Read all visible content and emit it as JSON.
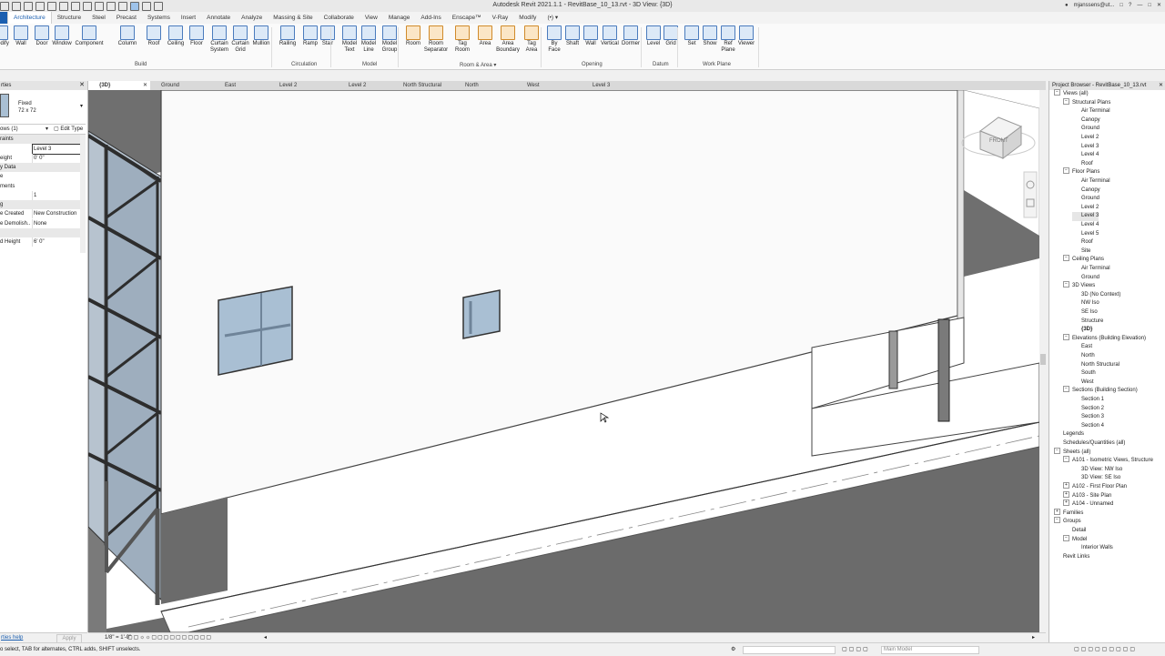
{
  "app_title": "Autodesk Revit 2021.1.1 - RevitBase_10_13.rvt - 3D View: {3D}",
  "user": "mjanssens@ut...",
  "ribbon_tabs": [
    "Architecture",
    "Structure",
    "Steel",
    "Precast",
    "Systems",
    "Insert",
    "Annotate",
    "Analyze",
    "Massing & Site",
    "Collaborate",
    "View",
    "Manage",
    "Add-Ins",
    "Enscape™",
    "V-Ray",
    "Modify"
  ],
  "ribbon_active_tab": "Architecture",
  "ribbon_buttons": [
    "Modify",
    "Wall",
    "Door",
    "Window",
    "Component",
    "Column",
    "Roof",
    "Ceiling",
    "Floor",
    "Curtain\nSystem",
    "Curtain\nGrid",
    "Mullion",
    "Railing",
    "Ramp",
    "Stair",
    "Model\nText",
    "Model\nLine",
    "Model\nGroup",
    "Room",
    "Room\nSeparator",
    "Tag\nRoom",
    "Area",
    "Area\nBoundary",
    "Tag\nArea",
    "By\nFace",
    "Shaft",
    "Wall",
    "Vertical",
    "Dormer",
    "Level",
    "Grid",
    "Set",
    "Show",
    "Ref\nPlane",
    "Viewer"
  ],
  "ribbon_groups": [
    "Build",
    "Circulation",
    "Model",
    "Room & Area ▾",
    "Opening",
    "Datum",
    "Work Plane"
  ],
  "properties": {
    "title": "rties",
    "type_name": "Fixed",
    "type_size": "72 x 72",
    "selector": "ows (1)",
    "edit_type": "Edit Type",
    "rows": [
      {
        "k": "raints",
        "v": "",
        "section": true
      },
      {
        "k": "",
        "v": "Level 3"
      },
      {
        "k": "eight",
        "v": "0'  0\""
      },
      {
        "k": "y Data",
        "v": "",
        "section": true
      },
      {
        "k": "e",
        "v": ""
      },
      {
        "k": "ments",
        "v": ""
      },
      {
        "k": "",
        "v": "1"
      },
      {
        "k": "g",
        "v": "",
        "section": true
      },
      {
        "k": "e Created",
        "v": "New Construction"
      },
      {
        "k": "e Demolish...",
        "v": "None"
      },
      {
        "k": "",
        "v": "",
        "section": true
      },
      {
        "k": "d Height",
        "v": "6'  0\""
      }
    ],
    "help_link": "rties help",
    "apply": "Apply"
  },
  "view_tabs": [
    "{3D}",
    "Ground",
    "East",
    "Level 2",
    "Level 2",
    "North Structural",
    "North",
    "West",
    "Level 3"
  ],
  "viewcube_label": "FRONT",
  "view_scale": "1/8\" = 1'-0\"",
  "browser": {
    "title": "Project Browser - RevitBase_10_13.rvt",
    "nodes": [
      {
        "t": "Views (all)",
        "d": 0,
        "e": "−"
      },
      {
        "t": "Structural Plans",
        "d": 1,
        "e": "−"
      },
      {
        "t": "Air Terminal",
        "d": 2
      },
      {
        "t": "Canopy",
        "d": 2
      },
      {
        "t": "Ground",
        "d": 2
      },
      {
        "t": "Level 2",
        "d": 2
      },
      {
        "t": "Level 3",
        "d": 2
      },
      {
        "t": "Level 4",
        "d": 2
      },
      {
        "t": "Roof",
        "d": 2
      },
      {
        "t": "Floor Plans",
        "d": 1,
        "e": "−"
      },
      {
        "t": "Air Terminal",
        "d": 2
      },
      {
        "t": "Canopy",
        "d": 2
      },
      {
        "t": "Ground",
        "d": 2
      },
      {
        "t": "Level 2",
        "d": 2
      },
      {
        "t": "Level 3",
        "d": 2,
        "sel": true
      },
      {
        "t": "Level 4",
        "d": 2
      },
      {
        "t": "Level 5",
        "d": 2
      },
      {
        "t": "Roof",
        "d": 2
      },
      {
        "t": "Site",
        "d": 2
      },
      {
        "t": "Ceiling Plans",
        "d": 1,
        "e": "−"
      },
      {
        "t": "Air Terminal",
        "d": 2
      },
      {
        "t": "Ground",
        "d": 2
      },
      {
        "t": "3D Views",
        "d": 1,
        "e": "−"
      },
      {
        "t": "3D (No Context)",
        "d": 2
      },
      {
        "t": "NW Iso",
        "d": 2
      },
      {
        "t": "SE Iso",
        "d": 2
      },
      {
        "t": "Structure",
        "d": 2
      },
      {
        "t": "{3D}",
        "d": 2,
        "bold": true
      },
      {
        "t": "Elevations (Building Elevation)",
        "d": 1,
        "e": "−"
      },
      {
        "t": "East",
        "d": 2
      },
      {
        "t": "North",
        "d": 2
      },
      {
        "t": "North Structural",
        "d": 2
      },
      {
        "t": "South",
        "d": 2
      },
      {
        "t": "West",
        "d": 2
      },
      {
        "t": "Sections (Building Section)",
        "d": 1,
        "e": "−"
      },
      {
        "t": "Section 1",
        "d": 2
      },
      {
        "t": "Section 2",
        "d": 2
      },
      {
        "t": "Section 3",
        "d": 2
      },
      {
        "t": "Section 4",
        "d": 2
      },
      {
        "t": "Legends",
        "d": 0
      },
      {
        "t": "Schedules/Quantities (all)",
        "d": 0
      },
      {
        "t": "Sheets (all)",
        "d": 0,
        "e": "−"
      },
      {
        "t": "A101 - Isometric Views, Structure",
        "d": 1,
        "e": "−"
      },
      {
        "t": "3D View: NW Iso",
        "d": 2
      },
      {
        "t": "3D View: SE Iso",
        "d": 2
      },
      {
        "t": "A102 - First Floor Plan",
        "d": 1,
        "e": "+"
      },
      {
        "t": "A103 - Site Plan",
        "d": 1,
        "e": "+"
      },
      {
        "t": "A104 - Unnamed",
        "d": 1,
        "e": "+"
      },
      {
        "t": "Families",
        "d": 0,
        "e": "+"
      },
      {
        "t": "Groups",
        "d": 0,
        "e": "−"
      },
      {
        "t": "Detail",
        "d": 1
      },
      {
        "t": "Model",
        "d": 1,
        "e": "−"
      },
      {
        "t": "Interior Walls",
        "d": 2
      },
      {
        "t": "Revit Links",
        "d": 0
      }
    ]
  },
  "status_text": "o select, TAB for alternates, CTRL adds, SHIFT unselects.",
  "status_model": "Main Model",
  "colors": {
    "accent": "#1b5fb0",
    "canvas": "#ffffff",
    "dark_wall": "#6f6f6f",
    "glass": "#a9bfd3"
  }
}
